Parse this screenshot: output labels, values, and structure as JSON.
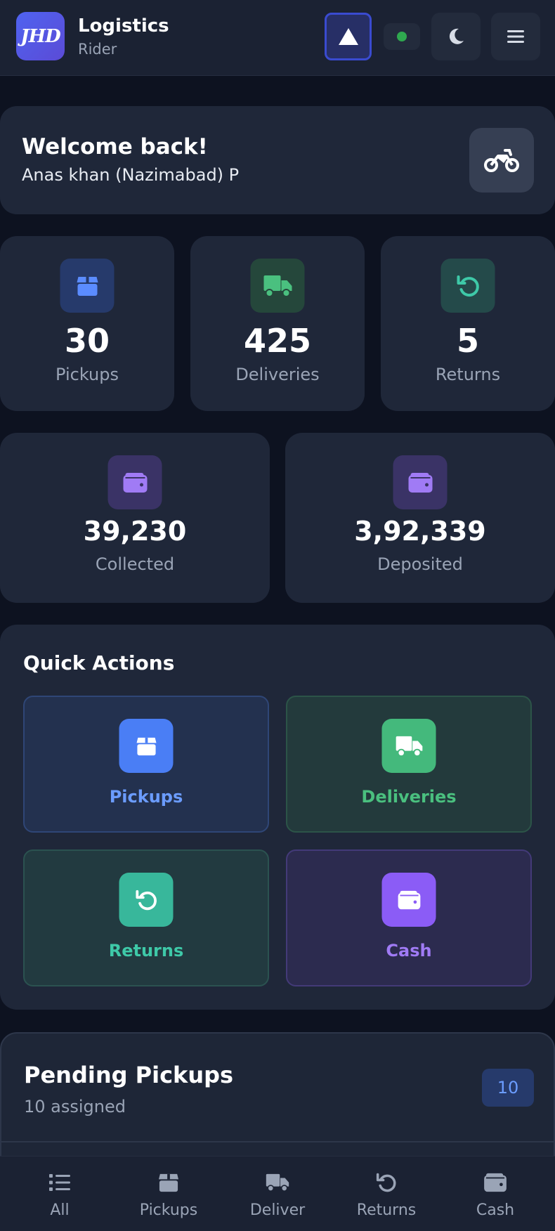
{
  "header": {
    "logo_text": "JHD",
    "title": "Logistics",
    "subtitle": "Rider",
    "colors": {
      "background": "#1b2233",
      "status_online": "#2fa84f"
    }
  },
  "welcome": {
    "title": "Welcome back!",
    "rider_name": "Anas khan (Nazimabad) P"
  },
  "stats": [
    {
      "value": "30",
      "label": "Pickups",
      "icon": "box-icon",
      "color": "#5b8cff"
    },
    {
      "value": "425",
      "label": "Deliveries",
      "icon": "truck-icon",
      "color": "#4ac07f"
    },
    {
      "value": "5",
      "label": "Returns",
      "icon": "undo-icon",
      "color": "#3ec9a8"
    }
  ],
  "cash": [
    {
      "value": "39,230",
      "label": "Collected",
      "icon": "wallet-icon",
      "color": "#a07bf5"
    },
    {
      "value": "3,92,339",
      "label": "Deposited",
      "icon": "wallet-icon",
      "color": "#a07bf5"
    }
  ],
  "quick_actions": {
    "title": "Quick Actions",
    "items": [
      {
        "label": "Pickups",
        "icon": "box-icon",
        "color": "#6b9cff"
      },
      {
        "label": "Deliveries",
        "icon": "truck-icon",
        "color": "#4ac07f"
      },
      {
        "label": "Returns",
        "icon": "undo-icon",
        "color": "#3ec9a8"
      },
      {
        "label": "Cash",
        "icon": "wallet-icon",
        "color": "#a07bf5"
      }
    ]
  },
  "pending_pickups": {
    "title": "Pending Pickups",
    "subtitle": "10 assigned",
    "count": "10"
  },
  "bottom_nav": [
    {
      "label": "All",
      "icon": "list-icon"
    },
    {
      "label": "Pickups",
      "icon": "box-icon"
    },
    {
      "label": "Deliver",
      "icon": "truck-icon"
    },
    {
      "label": "Returns",
      "icon": "undo-icon"
    },
    {
      "label": "Cash",
      "icon": "wallet-icon"
    }
  ]
}
